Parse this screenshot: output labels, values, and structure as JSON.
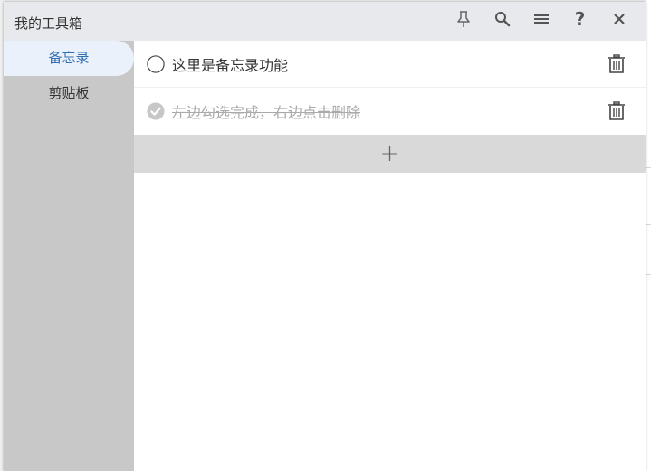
{
  "window": {
    "title": "我的工具箱"
  },
  "toolbar": {
    "icons": [
      "pin-icon",
      "search-icon",
      "menu-icon",
      "help-icon",
      "close-icon"
    ],
    "help_glyph": "?",
    "close_glyph": "✕"
  },
  "sidebar": {
    "items": [
      {
        "label": "备忘录",
        "active": true
      },
      {
        "label": "剪贴板",
        "active": false
      }
    ]
  },
  "memo": {
    "items": [
      {
        "text": "这里是备忘录功能",
        "done": false
      },
      {
        "text": "左边勾选完成，右边点击删除",
        "done": true
      }
    ],
    "add_glyph": "+"
  },
  "colors": {
    "titlebar": "#e8e9ec",
    "sidebar": "#c8c8c8",
    "active_item_bg": "#eaf1fb",
    "active_item_text": "#2f6fb3",
    "add_bar": "#d9d9d9"
  }
}
